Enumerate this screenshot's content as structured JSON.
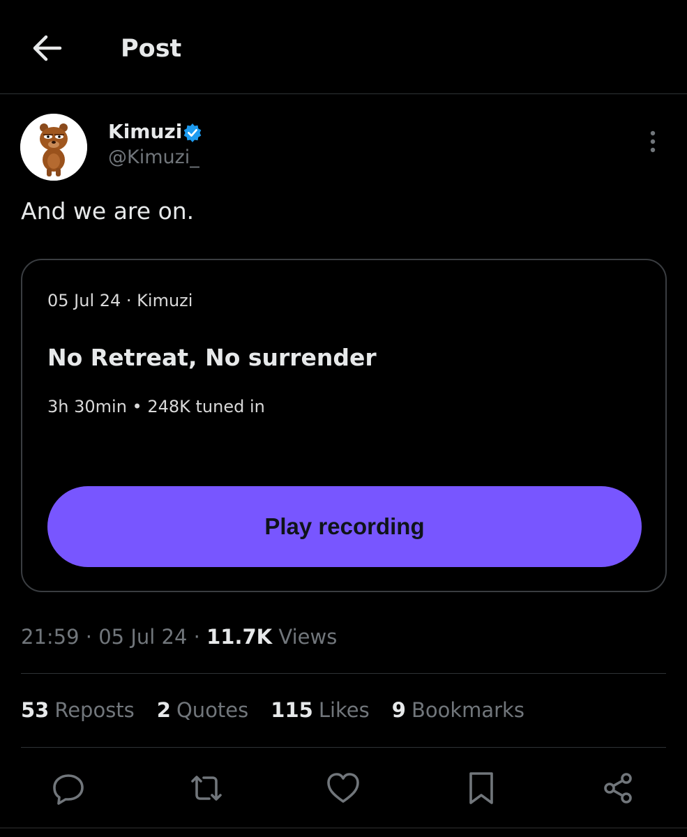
{
  "header": {
    "back_icon": "arrow-left-icon",
    "title": "Post"
  },
  "author": {
    "name": "Kimuzi",
    "handle": "@Kimuzi_",
    "verified": true,
    "verified_color": "#1d9bf0"
  },
  "post": {
    "text": "And we are on."
  },
  "space_card": {
    "meta": "05 Jul 24 · Kimuzi",
    "title": "No Retreat, No surrender",
    "stats": "3h 30min • 248K tuned in",
    "button_label": "Play recording",
    "button_color": "#7856ff"
  },
  "timestamp": {
    "time_date": "21:59 · 05 Jul 24 · ",
    "views_count": "11.7K",
    "views_label": " Views"
  },
  "engagement": [
    {
      "count": "53",
      "label": "Reposts"
    },
    {
      "count": "2",
      "label": "Quotes"
    },
    {
      "count": "115",
      "label": "Likes"
    },
    {
      "count": "9",
      "label": "Bookmarks"
    }
  ],
  "actions": [
    "reply-icon",
    "repost-icon",
    "like-icon",
    "bookmark-icon",
    "share-icon"
  ]
}
